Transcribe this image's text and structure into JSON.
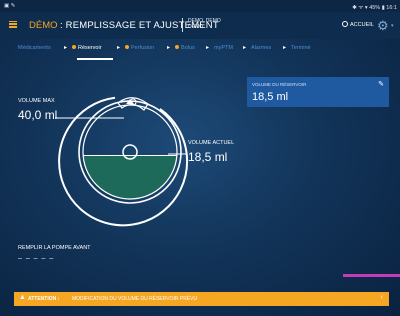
{
  "status_bar": {
    "left": "▣ ✎",
    "right": "✱ ᯤ ▾ 45% ▮ 16:1"
  },
  "header": {
    "demo_tag": "DÉMO",
    "title": ": REMPLISSAGE ET AJUSTEMENT",
    "user_line1": "DEMO, DEMO",
    "user_line2": "DEMO",
    "home_label": "ACCUEIL"
  },
  "tabs": [
    {
      "label": "Médicaments",
      "dot": false,
      "active": false
    },
    {
      "label": "Réservoir",
      "dot": true,
      "active": true
    },
    {
      "label": "Perfusion",
      "dot": true,
      "active": false
    },
    {
      "label": "Bolus",
      "dot": true,
      "active": false
    },
    {
      "label": "myPTM",
      "dot": false,
      "active": false
    },
    {
      "label": "Alarmes",
      "dot": false,
      "active": false
    },
    {
      "label": "Terminé",
      "dot": false,
      "active": false
    }
  ],
  "volume_max": {
    "label": "VOLUME MAX",
    "value": "40,0 ml"
  },
  "volume_actuel": {
    "label": "VOLUME ACTUEL",
    "value": "18,5 ml",
    "fill_fraction": 0.4625
  },
  "reservoir_card": {
    "label": "VOLUME DU RÉSERVOIR",
    "value": "18,5 ml"
  },
  "prefill": {
    "label": "REMPLIR LA POMPE AVANT",
    "value": "– – – – –"
  },
  "alert": {
    "attention": "ATTENTION :",
    "message": "MODIFICATION DU VOLUME DU RÉSERVOIR PRÉVU"
  },
  "colors": {
    "accent": "#f5a623",
    "fluid": "#1e6a5a",
    "card": "#1f5aa0",
    "tab_inactive": "#4b8fd6",
    "indicator": "#c43ab7"
  }
}
